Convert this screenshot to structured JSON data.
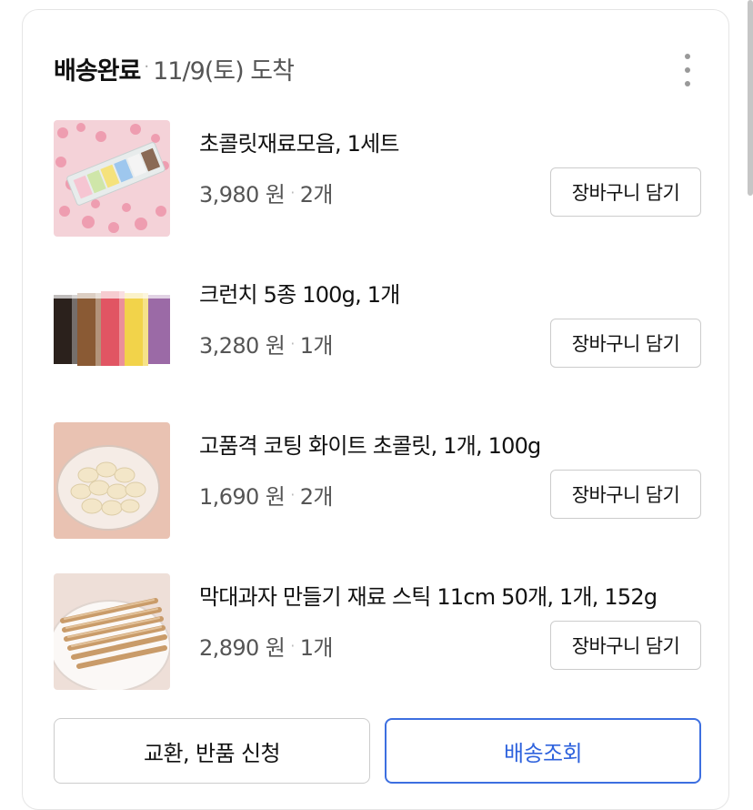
{
  "order": {
    "status": "배송완료",
    "separator": "·",
    "arrival": "11/9(토) 도착"
  },
  "items": [
    {
      "name": "초콜릿재료모음, 1세트",
      "price": "3,980 원",
      "qty": "2개",
      "cart_label": "장바구니 담기",
      "image": "sprinkles-pink-thumbnail"
    },
    {
      "name": "크런치 5종 100g, 1개",
      "price": "3,280 원",
      "qty": "1개",
      "cart_label": "장바구니 담기",
      "image": "crunch-bags-thumbnail"
    },
    {
      "name": "고품격 코팅 화이트 초콜릿, 1개, 100g",
      "price": "1,690 원",
      "qty": "2개",
      "cart_label": "장바구니 담기",
      "image": "white-chocolate-bowl-thumbnail"
    },
    {
      "name": "막대과자 만들기 재료 스틱 11cm 50개, 1개, 152g",
      "price": "2,890 원",
      "qty": "1개",
      "cart_label": "장바구니 담기",
      "image": "biscuit-sticks-plate-thumbnail"
    }
  ],
  "actions": {
    "return_label": "교환, 반품 신청",
    "track_label": "배송조회"
  },
  "colors": {
    "accent": "#2f63dd",
    "border": "#cccccc"
  }
}
